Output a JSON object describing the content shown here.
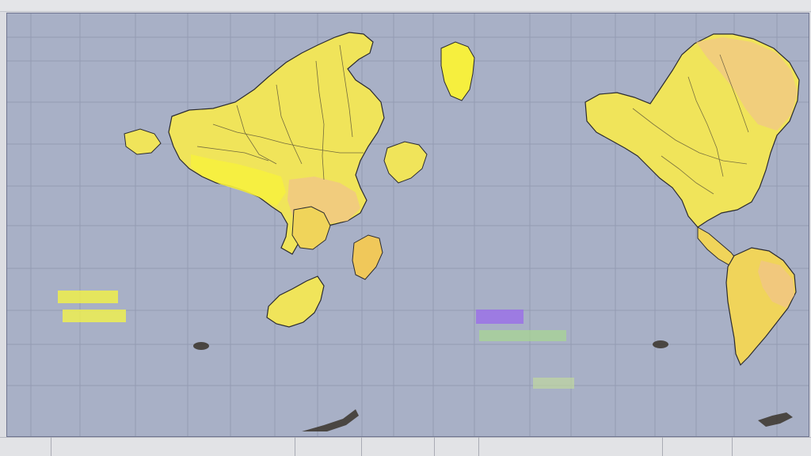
{
  "map": {
    "ocean_color": "#a8b0c6",
    "land_color": "#f0e45a",
    "highlight_land_color": "#f6ef3e",
    "grid_color": "#8c93ab",
    "warm_region_color": "#f1c48a",
    "outline_color": "#2b2b30"
  },
  "legends": {
    "left": {
      "bar_colors": [
        "#f0f04a",
        "#eef050"
      ],
      "rows": [
        "",
        "",
        "",
        "",
        ""
      ]
    },
    "right": {
      "bar_colors": [
        "#9a6ee8",
        "#a8d890",
        "#c0d8a0"
      ],
      "rows": [
        "",
        "",
        "",
        "",
        ""
      ]
    }
  }
}
